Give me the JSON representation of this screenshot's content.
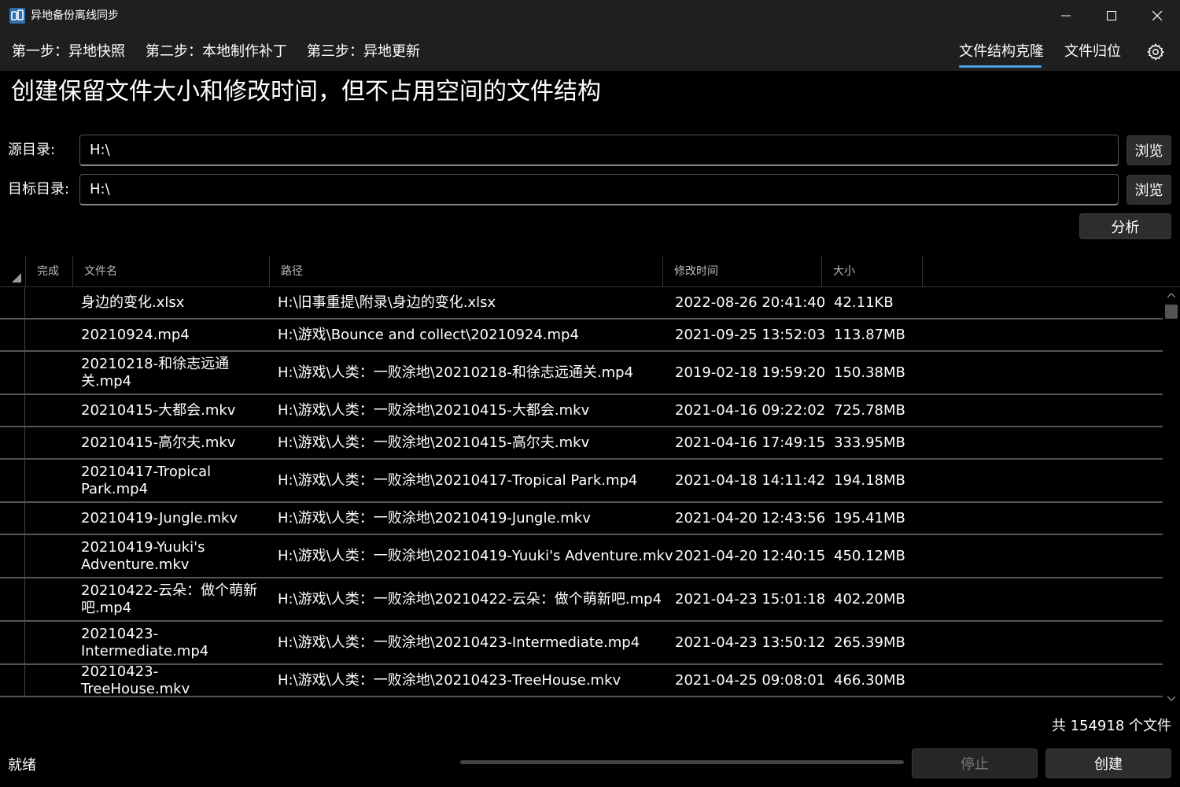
{
  "window": {
    "title": "异地备份离线同步"
  },
  "nav": {
    "steps": [
      "第一步：异地快照",
      "第二步：本地制作补丁",
      "第三步：异地更新"
    ],
    "right": [
      "文件结构克隆",
      "文件归位"
    ],
    "active": "文件结构克隆"
  },
  "heading": "创建保留文件大小和修改时间，但不占用空间的文件结构",
  "source": {
    "label": "源目录:",
    "value": "H:\\",
    "browse": "浏览"
  },
  "target": {
    "label": "目标目录:",
    "value": "H:\\",
    "browse": "浏览"
  },
  "analyze_label": "分析",
  "table": {
    "headers": {
      "done": "完成",
      "name": "文件名",
      "path": "路径",
      "mtime": "修改时间",
      "size": "大小"
    },
    "rows": [
      {
        "name": "身边的变化.xlsx",
        "path": "H:\\旧事重提\\附录\\身边的变化.xlsx",
        "mtime": "2022-08-26 20:41:40",
        "size": "42.11KB"
      },
      {
        "name": "20210924.mp4",
        "path": "H:\\游戏\\Bounce and collect\\20210924.mp4",
        "mtime": "2021-09-25 13:52:03",
        "size": "113.87MB"
      },
      {
        "name": "20210218-和徐志远通关.mp4",
        "path": "H:\\游戏\\人类：一败涂地\\20210218-和徐志远通关.mp4",
        "mtime": "2019-02-18 19:59:20",
        "size": "150.38MB"
      },
      {
        "name": "20210415-大都会.mkv",
        "path": "H:\\游戏\\人类：一败涂地\\20210415-大都会.mkv",
        "mtime": "2021-04-16 09:22:02",
        "size": "725.78MB"
      },
      {
        "name": "20210415-高尔夫.mkv",
        "path": "H:\\游戏\\人类：一败涂地\\20210415-高尔夫.mkv",
        "mtime": "2021-04-16 17:49:15",
        "size": "333.95MB"
      },
      {
        "name": "20210417-Tropical Park.mp4",
        "path": "H:\\游戏\\人类：一败涂地\\20210417-Tropical Park.mp4",
        "mtime": "2021-04-18 14:11:42",
        "size": "194.18MB"
      },
      {
        "name": "20210419-Jungle.mkv",
        "path": "H:\\游戏\\人类：一败涂地\\20210419-Jungle.mkv",
        "mtime": "2021-04-20 12:43:56",
        "size": "195.41MB"
      },
      {
        "name": "20210419-Yuuki's Adventure.mkv",
        "path": "H:\\游戏\\人类：一败涂地\\20210419-Yuuki's Adventure.mkv",
        "mtime": "2021-04-20 12:40:15",
        "size": "450.12MB"
      },
      {
        "name": "20210422-云朵：做个萌新吧.mp4",
        "path": "H:\\游戏\\人类：一败涂地\\20210422-云朵：做个萌新吧.mp4",
        "mtime": "2021-04-23 15:01:18",
        "size": "402.20MB"
      },
      {
        "name": "20210423-Intermediate.mp4",
        "path": "H:\\游戏\\人类：一败涂地\\20210423-Intermediate.mp4",
        "mtime": "2021-04-23 13:50:12",
        "size": "265.39MB"
      },
      {
        "name": "20210423-TreeHouse.mkv",
        "path": "H:\\游戏\\人类：一败涂地\\20210423-TreeHouse.mkv",
        "mtime": "2021-04-25 09:08:01",
        "size": "466.30MB"
      }
    ]
  },
  "file_count": "共 154918 个文件",
  "status_text": "就绪",
  "progress": 0,
  "stop_label": "停止",
  "create_label": "创建",
  "colors": {
    "accent": "#4aa0e6",
    "chrome": "#1f1f1f",
    "background": "#000000"
  }
}
